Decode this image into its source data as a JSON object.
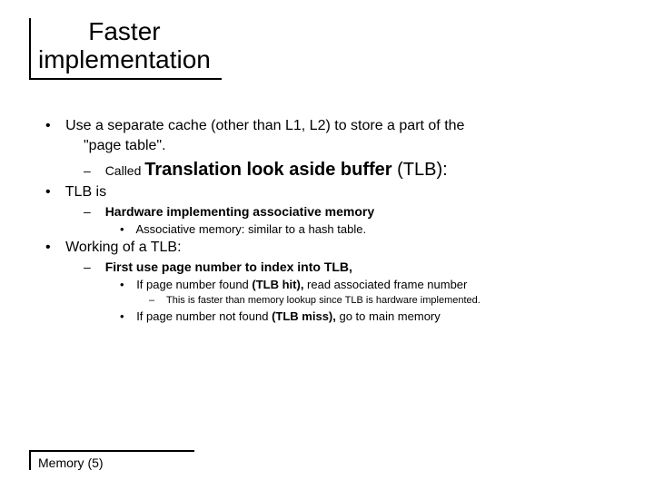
{
  "title": {
    "line1": "Faster",
    "line2": "implementation"
  },
  "bullets": {
    "b1a": "Use a separate cache (other than L1, L2) to store a part of the",
    "b1a_cont": "\"page table\".",
    "b1a_sub_prefix": "Called ",
    "b1a_sub_big": "Translation look aside buffer ",
    "b1a_sub_suffix": "(TLB):",
    "b1b": "TLB is",
    "b1b_sub1": "Hardware implementing associative memory",
    "b1b_sub1_sub": "Associative memory: similar to a hash table.",
    "b1c": "Working of a TLB:",
    "b1c_sub1": "First use page number to index into TLB,",
    "b1c_sub1_a_pre": "If page number found ",
    "b1c_sub1_a_bold": "(TLB hit),",
    "b1c_sub1_a_post": " read associated frame number",
    "b1c_sub1_a_sub": "This is faster than memory lookup since TLB is hardware implemented.",
    "b1c_sub1_b_pre": "If page number not found ",
    "b1c_sub1_b_bold": "(TLB miss),",
    "b1c_sub1_b_post": " go to main memory"
  },
  "footer": "Memory (5)"
}
